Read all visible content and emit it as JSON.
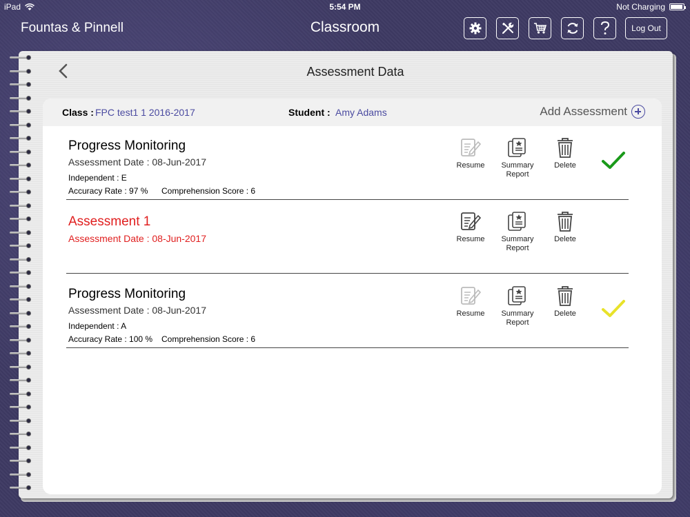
{
  "status_bar": {
    "device": "iPad",
    "time": "5:54 PM",
    "charging": "Not Charging"
  },
  "header": {
    "app_title": "Fountas & Pinnell",
    "screen_title": "Classroom",
    "logout_label": "Log Out"
  },
  "page": {
    "title": "Assessment Data"
  },
  "class_bar": {
    "class_label": "Class :",
    "class_value": "FPC test1 1 2016-2017",
    "student_label": "Student :",
    "student_value": "Amy Adams",
    "add_label": "Add Assessment"
  },
  "actions": {
    "resume": "Resume",
    "summary_line1": "Summary",
    "summary_line2": "Report",
    "delete": "Delete"
  },
  "assessments": [
    {
      "title": "Progress Monitoring",
      "date": "Assessment Date : 08-Jun-2017",
      "independent": "Independent : E",
      "accuracy": "Accuracy Rate : 97 %",
      "comprehension": "Comprehension Score : 6",
      "status": "complete",
      "check_color": "#1a9a1a"
    },
    {
      "title": "Assessment 1",
      "date": "Assessment Date : 08-Jun-2017",
      "status": "in-progress"
    },
    {
      "title": "Progress Monitoring",
      "date": "Assessment Date : 08-Jun-2017",
      "independent": "Independent : A",
      "accuracy": "Accuracy Rate : 100 %",
      "comprehension": "Comprehension Score : 6",
      "status": "complete",
      "check_color": "#e8e22a"
    }
  ],
  "colors": {
    "background": "#3e3a63",
    "accent": "#4a4aa0",
    "incomplete": "#e01e1e"
  }
}
